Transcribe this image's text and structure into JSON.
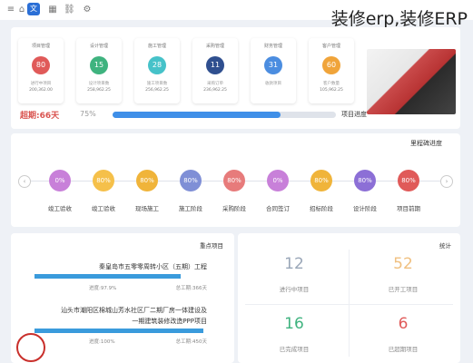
{
  "overlay_title": "装修erp,装修ERP",
  "topbar": {
    "logo_text": "文"
  },
  "cards": [
    {
      "title": "项目管理",
      "value": "80",
      "color": "#e05a59",
      "line1": "进行中项目",
      "line2": "200,362.00"
    },
    {
      "title": "设计管理",
      "value": "15",
      "color": "#3fb37f",
      "line1": "设计项目数",
      "line2": "258,962.25"
    },
    {
      "title": "施工管理",
      "value": "28",
      "color": "#46c2c9",
      "line1": "施工项目数",
      "line2": "256,962.25"
    },
    {
      "title": "采购管理",
      "value": "11",
      "color": "#2f4f8f",
      "line1": "采购订单",
      "line2": "236,962.25"
    },
    {
      "title": "财务管理",
      "value": "31",
      "color": "#4b8de0",
      "line1": "收款项目",
      "line2": ""
    },
    {
      "title": "客户管理",
      "value": "60",
      "color": "#f0a43a",
      "line1": "客户数量",
      "line2": "105,962.25"
    }
  ],
  "progress": {
    "overdue": "超期:66天",
    "percent_text": "75%",
    "percent_value": 0.75,
    "label": "项目进度"
  },
  "flow": {
    "heading": "里程碑进度",
    "nodes": [
      {
        "pct": "80%",
        "color": "#e05a59",
        "label": "项目前期"
      },
      {
        "pct": "80%",
        "color": "#8c6fd6",
        "label": "设计阶段"
      },
      {
        "pct": "80%",
        "color": "#f0b43a",
        "label": "招标阶段"
      },
      {
        "pct": "0%",
        "color": "#c880d9",
        "label": "合同签订"
      },
      {
        "pct": "80%",
        "color": "#e77b7b",
        "label": "采购阶段"
      },
      {
        "pct": "80%",
        "color": "#7f8fd6",
        "label": "施工阶段"
      },
      {
        "pct": "80%",
        "color": "#f0b43a",
        "label": "现场施工"
      },
      {
        "pct": "80%",
        "color": "#f5c04a",
        "label": "竣工验收"
      },
      {
        "pct": "0%",
        "color": "#c880d9",
        "label": "竣工验收"
      }
    ]
  },
  "projects": {
    "heading": "重点项目",
    "items": [
      {
        "title": "秦皇岛市五零零周转小区（五期）工程",
        "bar": 0.82,
        "meta_left": "总工期:366天",
        "meta_right": "进度:97.9%"
      },
      {
        "title": "汕头市潮阳区棉城山芳水社区厂二期厂房一体建设及",
        "title2": "一期建筑装修改造PPP项目",
        "bar": 0.95,
        "meta_left": "总工期:450天",
        "meta_right": "进度:100%"
      }
    ],
    "stamp": "印章"
  },
  "stats": {
    "heading": "统计",
    "items": [
      {
        "num": "52",
        "label": "已开工项目",
        "color": "#f0c080"
      },
      {
        "num": "12",
        "label": "进行中项目",
        "color": "#9aa7b8"
      },
      {
        "num": "6",
        "label": "已超期项目",
        "color": "#e05a59"
      },
      {
        "num": "16",
        "label": "已完成项目",
        "color": "#3fb37f"
      }
    ]
  }
}
